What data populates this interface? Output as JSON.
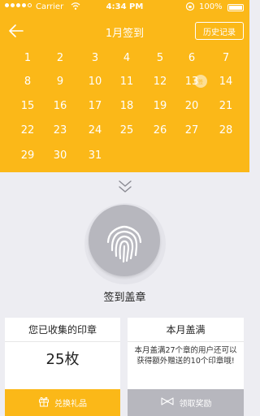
{
  "status_bar": {
    "carrier": "Carrier",
    "time": "4:34 PM",
    "battery": "100%",
    "signal_dots_filled": 4,
    "signal_dots_total": 5
  },
  "nav": {
    "title": "1月签到",
    "history_label": "历史记录",
    "back_icon": "back-arrow-icon"
  },
  "calendar": {
    "days": [
      "1",
      "2",
      "3",
      "4",
      "5",
      "6",
      "7",
      "8",
      "9",
      "10",
      "11",
      "12",
      "13",
      "14",
      "15",
      "16",
      "17",
      "18",
      "19",
      "20",
      "21",
      "22",
      "23",
      "24",
      "25",
      "26",
      "27",
      "28",
      "29",
      "30",
      "31"
    ],
    "stamped_days": [
      "13"
    ],
    "stamp_text": "签"
  },
  "sign_in": {
    "label": "签到盖章",
    "icon": "fingerprint-icon"
  },
  "collected": {
    "title": "您已收集的印章",
    "count": "25枚",
    "button_label": "兑换礼品",
    "button_icon": "gift-icon"
  },
  "monthly": {
    "title": "本月盖满",
    "description": "本月盖满27个章的用户还可以获得额外赠送的10个印章哦!",
    "button_label": "领取奖励",
    "button_icon": "bow-icon"
  },
  "colors": {
    "accent": "#fbb818",
    "background": "#ededf2",
    "disabled": "#b7b7be"
  }
}
